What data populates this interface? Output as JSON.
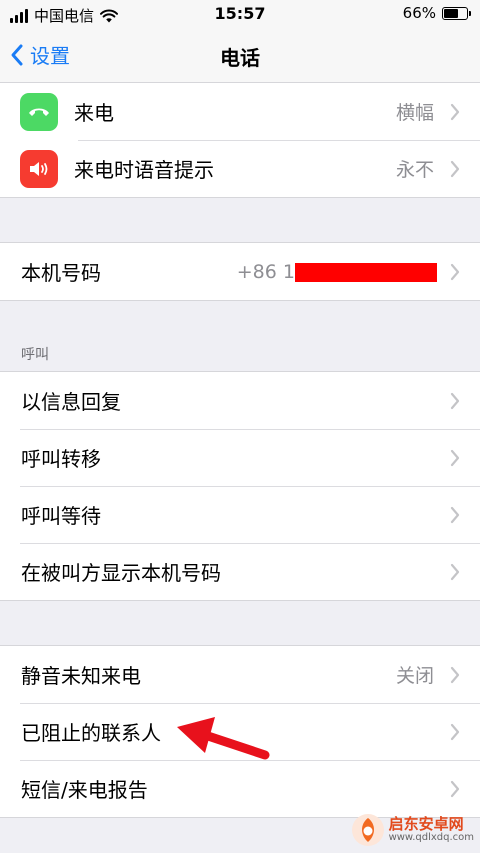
{
  "status": {
    "carrier": "中国电信",
    "time": "15:57",
    "battery": "66%",
    "battery_level": 0.66
  },
  "nav": {
    "back_label": "设置",
    "title": "电话"
  },
  "group1": [
    {
      "label": "来电",
      "value": "横幅",
      "icon": "phone-handset-icon",
      "icon_color": "#4cd964"
    },
    {
      "label": "来电时语音提示",
      "value": "永不",
      "icon": "speaker-icon",
      "icon_color": "#f63b30"
    }
  ],
  "group2": {
    "label": "本机号码",
    "value": "+86 1"
  },
  "call_section": {
    "header": "呼叫"
  },
  "group3": [
    "以信息回复",
    "呼叫转移",
    "呼叫等待",
    "在被叫方显示本机号码"
  ],
  "group4": [
    {
      "label": "静音未知来电",
      "value": "关闭"
    },
    {
      "label": "已阻止的联系人",
      "value": ""
    },
    {
      "label": "短信/来电报告",
      "value": ""
    }
  ],
  "watermark": {
    "title": "启东安卓网",
    "url": "www.qdlxdq.com"
  },
  "colors": {
    "accent": "#1a7cf5",
    "annotation_arrow": "#e8111c",
    "redaction": "#ff0000"
  }
}
